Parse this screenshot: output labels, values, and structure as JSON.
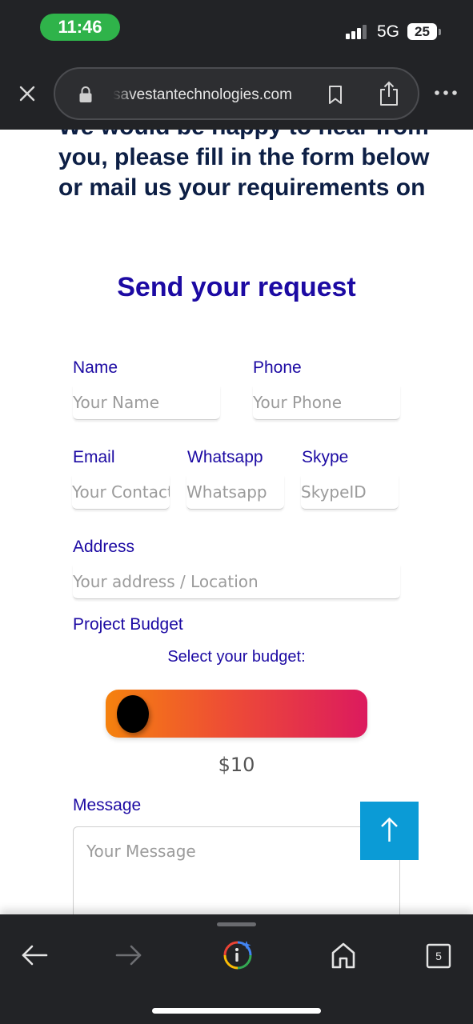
{
  "status_bar": {
    "time": "11:46",
    "network": "5G",
    "battery": "25"
  },
  "browser": {
    "url": "savestantechnologies.com",
    "close_icon": "close-icon",
    "lock_icon": "lock-icon",
    "bookmark_icon": "bookmark-icon",
    "share_icon": "share-icon",
    "more_icon": "more-icon"
  },
  "page": {
    "intro_line1": "We would be happy to hear from",
    "intro_line2": "you, please fill in the form below",
    "intro_line3": "or mail us your requirements on",
    "form_title": "Send your request"
  },
  "form": {
    "name_label": "Name",
    "name_placeholder": "Your Name",
    "phone_label": "Phone",
    "phone_placeholder": "Your Phone",
    "email_label": "Email",
    "email_placeholder": "Your Contact",
    "whatsapp_label": "Whatsapp",
    "whatsapp_placeholder": "Whatsapp",
    "skype_label": "Skype",
    "skype_placeholder": "SkypeID",
    "address_label": "Address",
    "address_placeholder": "Your address / Location",
    "budget_label": "Project Budget",
    "budget_hint": "Select your budget:",
    "budget_value": "$10",
    "budget_level": 0,
    "message_label": "Message",
    "message_placeholder": "Your Message"
  },
  "toolbar": {
    "tab_count": "5",
    "back_icon": "back-arrow-icon",
    "forward_icon": "forward-arrow-icon",
    "lens_icon": "google-lens-icon",
    "home_icon": "home-icon",
    "tabs_icon": "tabs-icon"
  },
  "colors": {
    "heading_blue": "#1c0aa3",
    "intro_navy": "#0d1f45",
    "chrome_dark": "#222326",
    "time_pill": "#2fb34a",
    "scroll_button": "#0b9bd6",
    "slider_start": "#f5820e",
    "slider_end": "#dc1a5e"
  }
}
